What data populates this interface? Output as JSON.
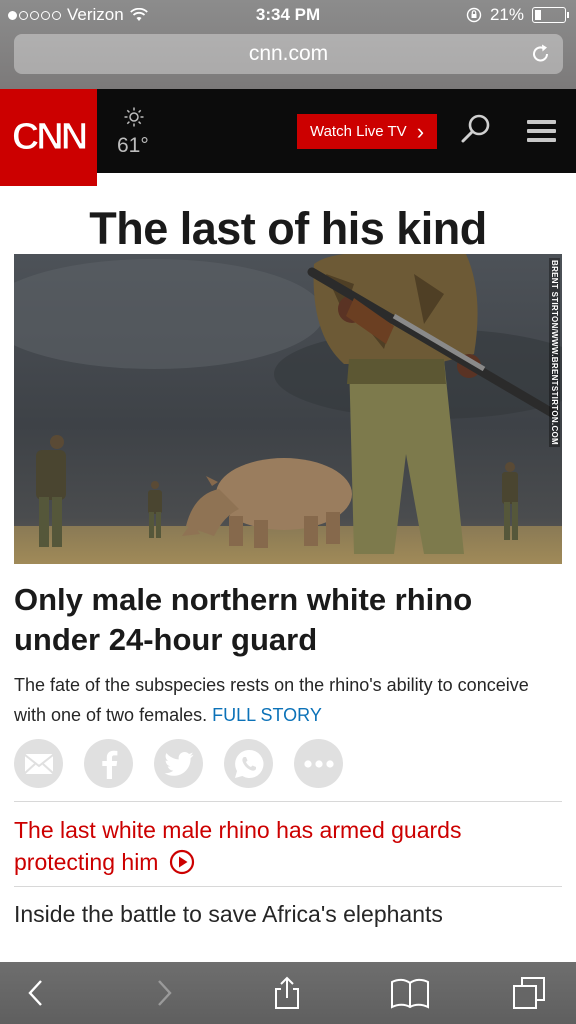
{
  "status_bar": {
    "carrier": "Verizon",
    "time": "3:34 PM",
    "battery": "21%",
    "signal_bars_filled": 1,
    "signal_bars_total": 5,
    "battery_level": 0.21
  },
  "browser": {
    "url": "cnn.com"
  },
  "header": {
    "logo": "CNN",
    "temperature": "61°",
    "weather_icon": "sun-icon",
    "watch_live_label": "Watch Live TV",
    "watch_live_chevron": "›"
  },
  "article": {
    "headline": "The last of his kind",
    "image_credit": "BRENT STIRTON/WWW.BRENTSTIRTON.COM",
    "story_title": "Only male northern white rhino under 24-hour guard",
    "story_desc": "The fate of the subspecies rests on the rhino's ability to conceive with one of two females.",
    "full_story_label": "FULL STORY"
  },
  "share": {
    "buttons": [
      "email-icon",
      "facebook-icon",
      "twitter-icon",
      "whatsapp-icon",
      "more-icon"
    ]
  },
  "related": [
    {
      "text": "The last white male rhino has armed guards protecting him",
      "has_video": true
    },
    {
      "text": "Inside the battle to save Africa's elephants",
      "has_video": false
    }
  ],
  "colors": {
    "cnn_red": "#cc0000",
    "link_blue": "#0c72b8",
    "header_black": "#0c0c0c"
  }
}
